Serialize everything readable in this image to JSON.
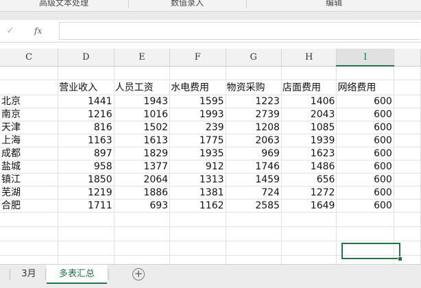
{
  "ribbon": {
    "groups": [
      "高级文本处理",
      "数值录入",
      "编辑"
    ]
  },
  "formula_bar": {
    "confirm_icon": "check-icon",
    "fx_label": "fx",
    "value": ""
  },
  "grid": {
    "columns": [
      "C",
      "D",
      "E",
      "F",
      "G",
      "H",
      "I"
    ],
    "selected_column": "I",
    "headers": [
      "",
      "营业收入",
      "人员工资",
      "水电费用",
      "物资采购",
      "店面费用",
      "网络费用"
    ],
    "rows": [
      [
        "北京",
        "1441",
        "1943",
        "1595",
        "1223",
        "1406",
        "600"
      ],
      [
        "南京",
        "1216",
        "1016",
        "1993",
        "2739",
        "2043",
        "600"
      ],
      [
        "天津",
        "816",
        "1502",
        "239",
        "1208",
        "1085",
        "600"
      ],
      [
        "上海",
        "1163",
        "1613",
        "1775",
        "2063",
        "1939",
        "600"
      ],
      [
        "成都",
        "897",
        "1829",
        "1935",
        "969",
        "1623",
        "600"
      ],
      [
        "盐城",
        "958",
        "1377",
        "912",
        "1746",
        "1486",
        "600"
      ],
      [
        "镇江",
        "1850",
        "2064",
        "1313",
        "1459",
        "656",
        "600"
      ],
      [
        "芜湖",
        "1219",
        "1886",
        "1381",
        "724",
        "1272",
        "600"
      ],
      [
        "合肥",
        "1711",
        "693",
        "1162",
        "2585",
        "1649",
        "600"
      ]
    ]
  },
  "tabs": {
    "items": [
      "3月",
      "多表汇总"
    ],
    "active": "多表汇总",
    "add_label": "+"
  },
  "colors": {
    "accent": "#217346"
  }
}
